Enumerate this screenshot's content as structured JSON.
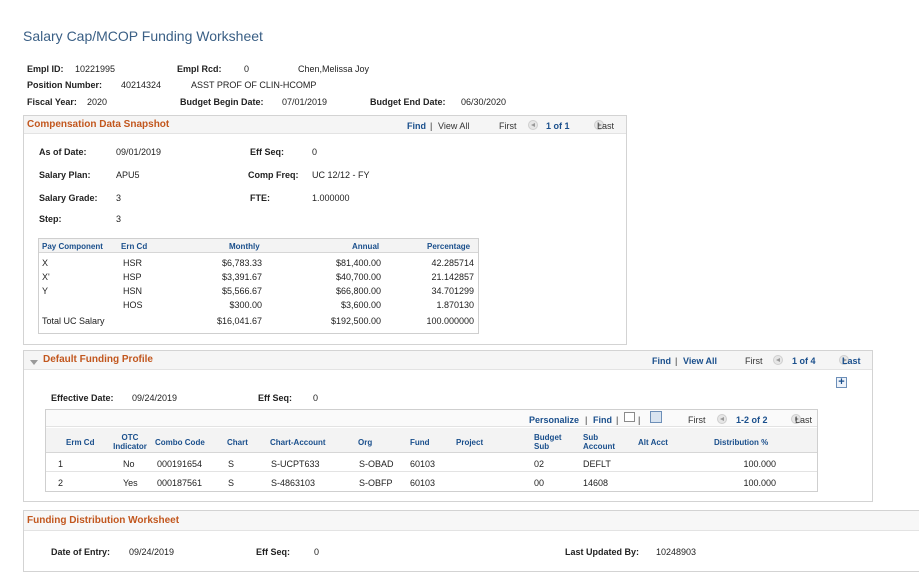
{
  "page_title": "Salary Cap/MCOP Funding Worksheet",
  "header": {
    "empl_id_label": "Empl ID:",
    "empl_id": "10221995",
    "empl_rcd_label": "Empl Rcd:",
    "empl_rcd": "0",
    "name": "Chen,Melissa Joy",
    "position_number_label": "Position Number:",
    "position_number": "40214324",
    "position_title": "ASST PROF OF CLIN-HCOMP",
    "fiscal_year_label": "Fiscal Year:",
    "fiscal_year": "2020",
    "budget_begin_label": "Budget Begin Date:",
    "budget_begin": "07/01/2019",
    "budget_end_label": "Budget End Date:",
    "budget_end": "06/30/2020"
  },
  "snapshot": {
    "title": "Compensation Data Snapshot",
    "find": "Find",
    "sep": "|",
    "view_all": "View All",
    "first": "First",
    "count": "1 of 1",
    "last": "Last",
    "as_of_label": "As of Date:",
    "as_of": "09/01/2019",
    "eff_seq_label": "Eff Seq:",
    "eff_seq": "0",
    "salary_plan_label": "Salary Plan:",
    "salary_plan": "APU5",
    "comp_freq_label": "Comp Freq:",
    "comp_freq": "UC 12/12 - FY",
    "salary_grade_label": "Salary Grade:",
    "salary_grade": "3",
    "fte_label": "FTE:",
    "fte": "1.000000",
    "step_label": "Step:",
    "step": "3",
    "columns": [
      "Pay Component",
      "Ern Cd",
      "Monthly",
      "Annual",
      "Percentage"
    ],
    "rows": [
      [
        "X",
        "HSR",
        "$6,783.33",
        "$81,400.00",
        "42.285714"
      ],
      [
        "X'",
        "HSP",
        "$3,391.67",
        "$40,700.00",
        "21.142857"
      ],
      [
        "Y",
        "HSN",
        "$5,566.67",
        "$66,800.00",
        "34.701299"
      ],
      [
        "",
        "HOS",
        "$300.00",
        "$3,600.00",
        "1.870130"
      ],
      [
        "Total UC Salary",
        "",
        "$16,041.67",
        "$192,500.00",
        "100.000000"
      ]
    ]
  },
  "funding_profile": {
    "title": "Default Funding Profile",
    "find": "Find",
    "sep": "|",
    "view_all": "View All",
    "first": "First",
    "count": "1 of 4",
    "last": "Last",
    "add": "+",
    "eff_date_label": "Effective Date:",
    "eff_date": "09/24/2019",
    "eff_seq_label": "Eff Seq:",
    "eff_seq": "0",
    "grid": {
      "personalize": "Personalize",
      "find": "Find",
      "first": "First",
      "count": "1-2 of 2",
      "last": "Last",
      "columns": [
        "Erm Cd",
        "OTC Indicator",
        "Combo Code",
        "Chart",
        "Chart-Account",
        "Org",
        "Fund",
        "Project",
        "Budget Sub",
        "Sub Account",
        "Alt Acct",
        "Distribution %"
      ],
      "rows": [
        [
          "1",
          "No",
          "000191654",
          "S",
          "S-UCPT633",
          "S-OBAD",
          "60103",
          "",
          "02",
          "DEFLT",
          "",
          "100.000"
        ],
        [
          "2",
          "Yes",
          "000187561",
          "S",
          "S-4863103",
          "S-OBFP",
          "60103",
          "",
          "00",
          "14608",
          "",
          "100.000"
        ]
      ]
    }
  },
  "distribution": {
    "title": "Funding Distribution Worksheet",
    "date_entry_label": "Date of Entry:",
    "date_entry": "09/24/2019",
    "eff_seq_label": "Eff Seq:",
    "eff_seq": "0",
    "last_updated_label": "Last Updated By:",
    "last_updated": "10248903"
  }
}
